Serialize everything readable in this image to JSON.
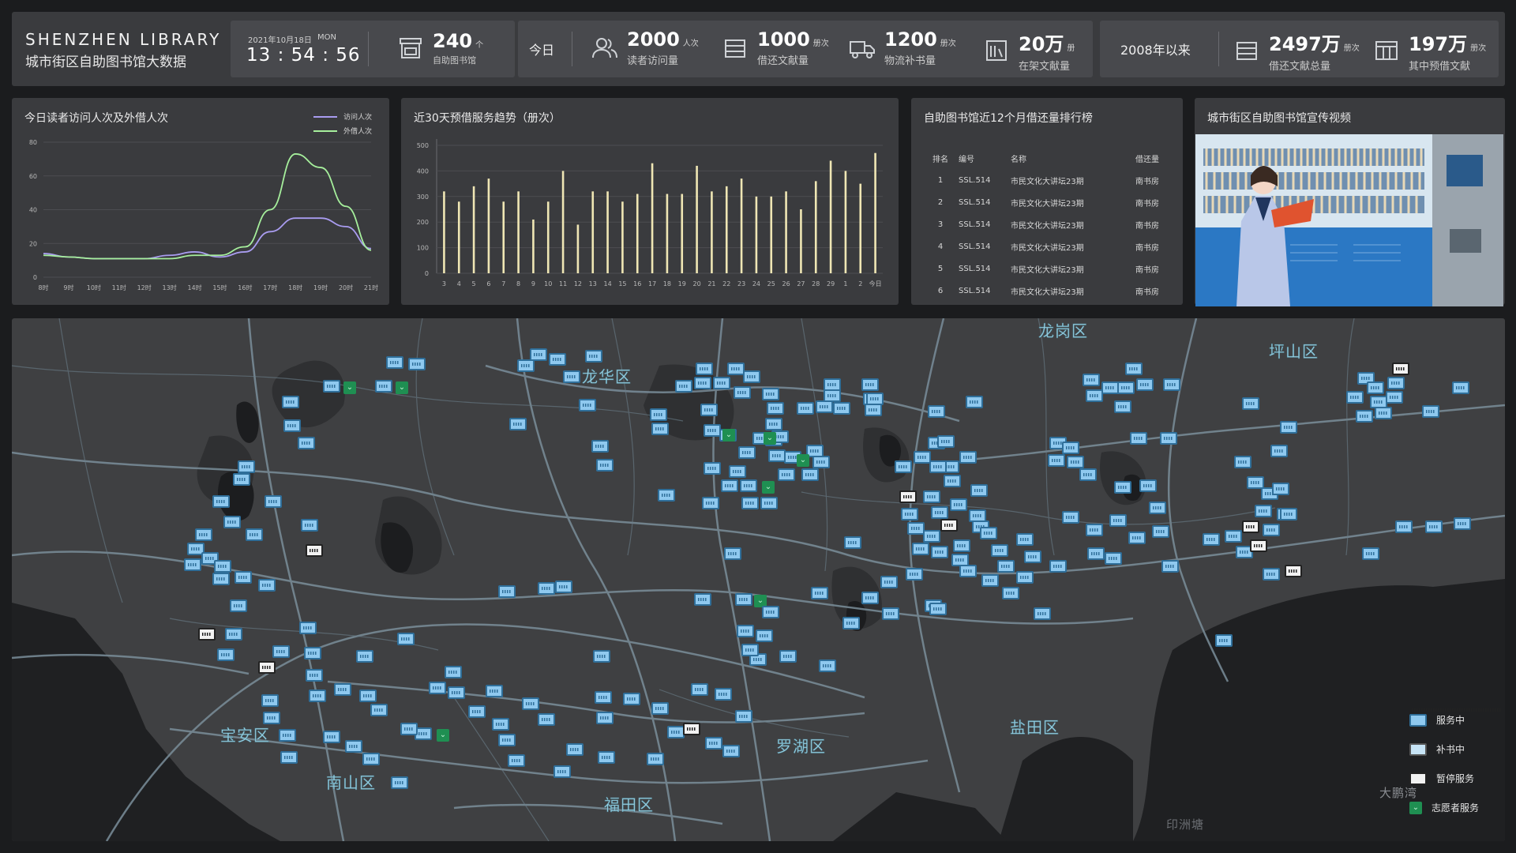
{
  "brand": {
    "title_en": "SHENZHEN LIBRARY",
    "title_cn": "城市街区自助图书馆大数据"
  },
  "datetime": {
    "date": "2021年10月18日",
    "day": "MON",
    "time": "13 : 54 : 56"
  },
  "libraries": {
    "value": "240",
    "unit": "个",
    "label": "自助图书馆",
    "icon": "kiosk-icon"
  },
  "today": {
    "label": "今日",
    "stats": [
      {
        "value": "2000",
        "unit": "人次",
        "label": "读者访问量",
        "icon": "users-icon"
      },
      {
        "value": "1000",
        "unit": "册次",
        "label": "借还文献量",
        "icon": "exchange-icon"
      },
      {
        "value": "1200",
        "unit": "册次",
        "label": "物流补书量",
        "icon": "truck-icon"
      },
      {
        "value": "20万",
        "unit": "册",
        "label": "在架文献量",
        "icon": "shelf-icon"
      }
    ]
  },
  "since2008": {
    "label": "2008年以来",
    "stats": [
      {
        "value": "2497万",
        "unit": "册次",
        "label": "借还文献总量",
        "icon": "exchange-icon"
      },
      {
        "value": "197万",
        "unit": "册次",
        "label": "其中预借文献",
        "icon": "book-icon"
      }
    ]
  },
  "visits_chart": {
    "title": "今日读者访问人次及外借人次",
    "chart_data": {
      "type": "line",
      "categories": [
        "8时",
        "9时",
        "10时",
        "11时",
        "12时",
        "13时",
        "14时",
        "15时",
        "16时",
        "17时",
        "18时",
        "19时",
        "20时",
        "21时"
      ],
      "ylim": [
        0,
        80
      ],
      "yticks": [
        "0",
        "20",
        "40",
        "60",
        "80"
      ],
      "series": [
        {
          "name": "访问人次",
          "color": "#a99cf0",
          "values": [
            14,
            12,
            11,
            11,
            11,
            13,
            15,
            12,
            15,
            27,
            35,
            35,
            30,
            17
          ]
        },
        {
          "name": "外借人次",
          "color": "#a6ef9c",
          "values": [
            13,
            12,
            11,
            11,
            11,
            11,
            13,
            13,
            18,
            40,
            73,
            65,
            42,
            16
          ]
        }
      ]
    }
  },
  "trend_chart": {
    "title": "近30天预借服务趋势（册次）",
    "chart_data": {
      "type": "bar",
      "categories": [
        "3",
        "4",
        "5",
        "6",
        "7",
        "8",
        "9",
        "10",
        "11",
        "12",
        "13",
        "14",
        "15",
        "16",
        "17",
        "18",
        "19",
        "20",
        "21",
        "22",
        "23",
        "24",
        "25",
        "26",
        "27",
        "28",
        "29",
        "1",
        "2",
        "今日"
      ],
      "values": [
        320,
        280,
        340,
        370,
        280,
        320,
        210,
        280,
        400,
        190,
        320,
        320,
        280,
        310,
        430,
        310,
        310,
        420,
        320,
        340,
        370,
        300,
        300,
        320,
        250,
        360,
        440,
        400,
        350,
        470
      ],
      "ylim": [
        0,
        500
      ],
      "yticks": [
        "0",
        "100",
        "200",
        "300",
        "400",
        "500"
      ],
      "color": "#efe6b4"
    }
  },
  "ranking": {
    "title": "自助图书馆近12个月借还量排行榜",
    "headers": [
      "排名",
      "编号",
      "名称",
      "借还量"
    ],
    "rows": [
      [
        "1",
        "SSL.514",
        "市民文化大讲坛23期",
        "南书房"
      ],
      [
        "2",
        "SSL.514",
        "市民文化大讲坛23期",
        "南书房"
      ],
      [
        "3",
        "SSL.514",
        "市民文化大讲坛23期",
        "南书房"
      ],
      [
        "4",
        "SSL.514",
        "市民文化大讲坛23期",
        "南书房"
      ],
      [
        "5",
        "SSL.514",
        "市民文化大讲坛23期",
        "南书房"
      ],
      [
        "6",
        "SSL.514",
        "市民文化大讲坛23期",
        "南书房"
      ]
    ]
  },
  "video": {
    "title": "城市街区自助图书馆宣传视频"
  },
  "map": {
    "districts": [
      "龙岗区",
      "坪山区",
      "龙华区",
      "宝安区",
      "南山区",
      "福田区",
      "罗湖区",
      "盐田区",
      "大鹏湾",
      "印洲塘"
    ],
    "legend": [
      {
        "type": "serving",
        "label": "服务中"
      },
      {
        "type": "restocking",
        "label": "补书中"
      },
      {
        "type": "paused",
        "label": "暂停服务"
      },
      {
        "type": "volunteer",
        "label": "志愿者服务"
      }
    ],
    "volunteer_symbol": "⌄",
    "colors": {
      "serving": "#8fc9ef",
      "paused": "#f2f2f2",
      "volunteer": "#1f8f52",
      "roads": "#7a8e9a",
      "water": "#1f2022"
    }
  }
}
